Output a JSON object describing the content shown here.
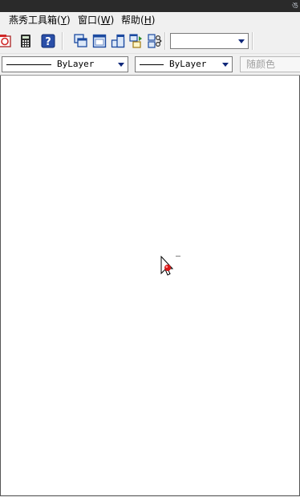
{
  "menubar": {
    "items": [
      {
        "label": "燕秀工具箱(",
        "mnemonic": "Y",
        "suffix": ")"
      },
      {
        "label": "窗口(",
        "mnemonic": "W",
        "suffix": ")"
      },
      {
        "label": "帮助(",
        "mnemonic": "H",
        "suffix": ")"
      }
    ]
  },
  "toolbar": {
    "icons": [
      "app-icon",
      "calculator-icon",
      "help-icon",
      "cascade-windows-icon",
      "single-window-icon",
      "tile-window-icon",
      "move-window-icon",
      "cut-window-icon"
    ],
    "dropdown_value": ""
  },
  "properties": {
    "linetype": "ByLayer",
    "lineweight": "ByLayer",
    "color_placeholder": "随颜色"
  },
  "colors": {
    "accent": "#10287a",
    "background": "#f0f0f0",
    "canvas": "#ffffff"
  }
}
